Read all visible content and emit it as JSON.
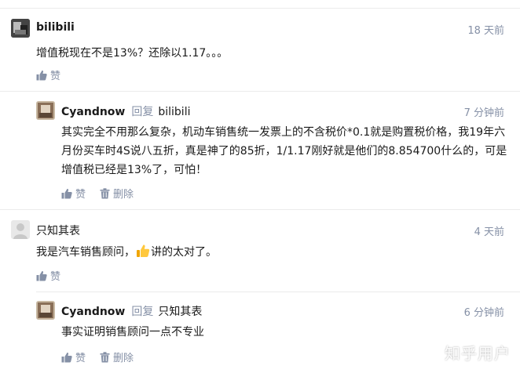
{
  "comments": [
    {
      "author": "bilibili",
      "time": "18 天前",
      "content": "增值税现在不是13%？还除以1.17。。。",
      "like_label": "赞"
    },
    {
      "author": "Cyandnow",
      "reply_word": "回复",
      "reply_to": "bilibili",
      "time": "7 分钟前",
      "content": "其实完全不用那么复杂，机动车销售统一发票上的不含税价*0.1就是购置税价格，我19年六月份买车时4S说八五折，真是神了的85折，1/1.17刚好就是他们的8.854700什么的，可是增值税已经是13%了，可怕！",
      "like_label": "赞",
      "delete_label": "删除"
    },
    {
      "author": "只知其表",
      "time": "4 天前",
      "content_before": "我是汽车销售顾问，",
      "content_after": "讲的太对了。",
      "like_label": "赞"
    },
    {
      "author": "Cyandnow",
      "reply_word": "回复",
      "reply_to": "只知其表",
      "time": "6 分钟前",
      "content": "事实证明销售顾问一点不专业",
      "like_label": "赞",
      "delete_label": "删除"
    }
  ],
  "watermark": "知乎用户",
  "colors": {
    "meta": "#8590a6",
    "text": "#1a1a1a",
    "divider": "#ebebeb"
  },
  "icons": {
    "like": "thumbs-up-icon",
    "delete": "trash-icon",
    "emoji": "thumbs-up-emoji"
  }
}
